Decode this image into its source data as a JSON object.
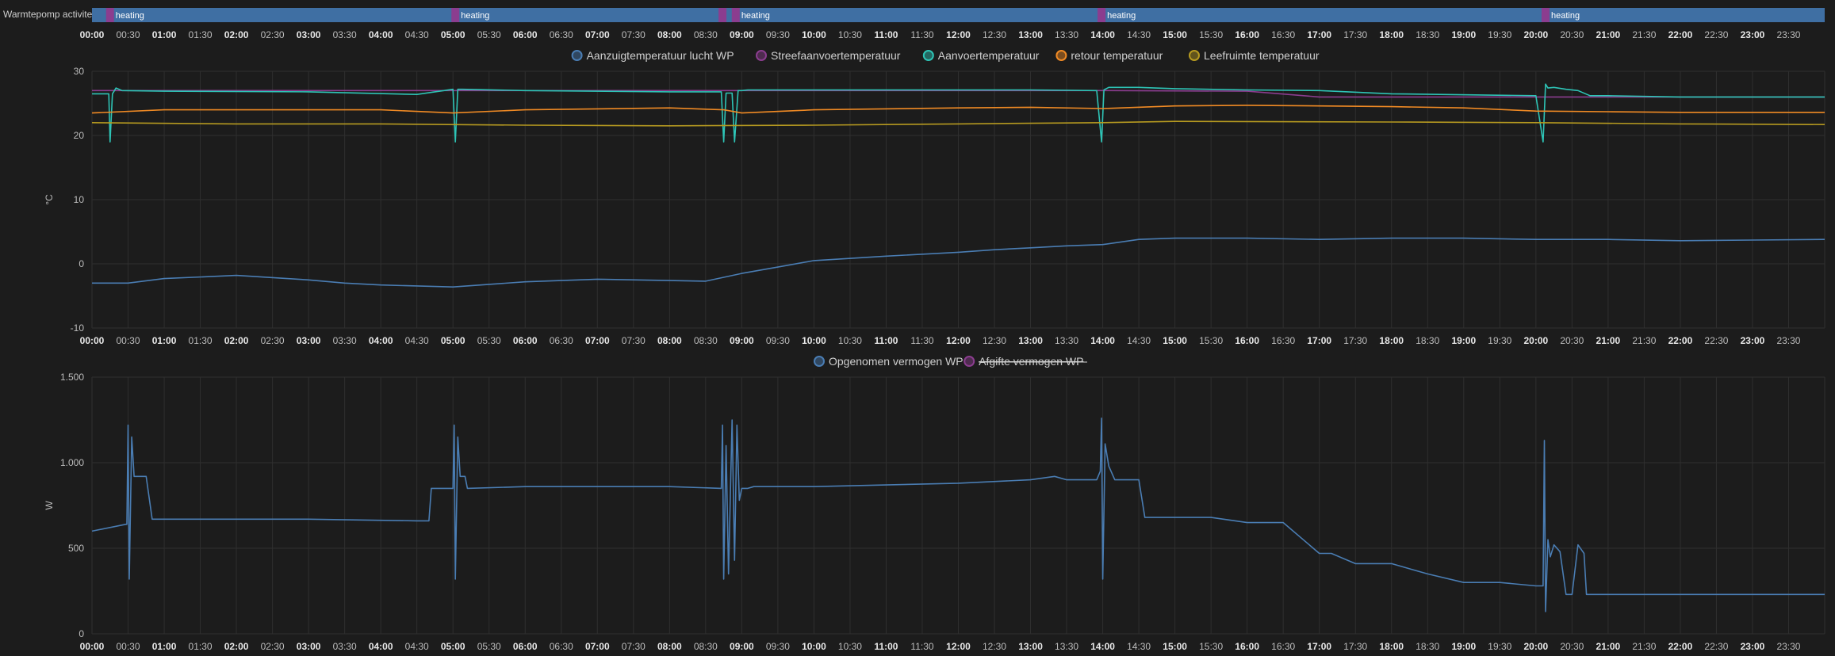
{
  "timeline": {
    "title": "Warmtepomp activiteit",
    "state_label": "heating",
    "color_heating": "#3f6fa3",
    "color_marker": "#8b3d8f",
    "segments": [
      {
        "start": "00:00",
        "end": "00:14",
        "label": "heating"
      },
      {
        "start": "00:17",
        "end": "05:00",
        "label": "heating"
      },
      {
        "start": "05:04",
        "end": "08:43",
        "label": "heating"
      },
      {
        "start": "08:46",
        "end": "08:54",
        "label": ""
      },
      {
        "start": "08:57",
        "end": "13:58",
        "label": "heating"
      },
      {
        "start": "14:01",
        "end": "20:07",
        "label": "heating"
      },
      {
        "start": "20:10",
        "end": "24:00",
        "label": "heating"
      }
    ],
    "markers": [
      "00:15",
      "05:02",
      "08:44",
      "08:55",
      "13:59",
      "20:08"
    ]
  },
  "time_ticks": [
    "00:00",
    "00:30",
    "01:00",
    "01:30",
    "02:00",
    "02:30",
    "03:00",
    "03:30",
    "04:00",
    "04:30",
    "05:00",
    "05:30",
    "06:00",
    "06:30",
    "07:00",
    "07:30",
    "08:00",
    "08:30",
    "09:00",
    "09:30",
    "10:00",
    "10:30",
    "11:00",
    "11:30",
    "12:00",
    "12:30",
    "13:00",
    "13:30",
    "14:00",
    "14:30",
    "15:00",
    "15:30",
    "16:00",
    "16:30",
    "17:00",
    "17:30",
    "18:00",
    "18:30",
    "19:00",
    "19:30",
    "20:00",
    "20:30",
    "21:00",
    "21:30",
    "22:00",
    "22:30",
    "23:00",
    "23:30"
  ],
  "chart_data": [
    {
      "type": "line",
      "ylabel": "°C",
      "ylim": [
        -10,
        30
      ],
      "yticks": [
        "-10",
        "0",
        "10",
        "20",
        "30"
      ],
      "x_range": [
        "00:00",
        "24:00"
      ],
      "grid": true,
      "legend_position": "top-center",
      "series": [
        {
          "name": "Aanzuigtemperatuur lucht WP",
          "color": "#4a7db3",
          "x": [
            "00:00",
            "00:30",
            "01:00",
            "02:00",
            "03:00",
            "03:30",
            "04:00",
            "05:00",
            "05:30",
            "06:00",
            "07:00",
            "08:00",
            "08:30",
            "09:00",
            "09:30",
            "10:00",
            "11:00",
            "12:00",
            "12:30",
            "13:00",
            "13:30",
            "14:00",
            "14:30",
            "15:00",
            "16:00",
            "17:00",
            "18:00",
            "19:00",
            "20:00",
            "21:00",
            "22:00",
            "23:00",
            "24:00"
          ],
          "values": [
            -3,
            -3,
            -2.3,
            -1.8,
            -2.5,
            -3,
            -3.3,
            -3.6,
            -3.2,
            -2.8,
            -2.4,
            -2.6,
            -2.7,
            -1.5,
            -0.5,
            0.5,
            1.2,
            1.8,
            2.2,
            2.5,
            2.8,
            3,
            3.8,
            4,
            4,
            3.8,
            4,
            4,
            3.8,
            3.8,
            3.6,
            3.7,
            3.8
          ]
        },
        {
          "name": "Streefaanvoertemperatuur",
          "color": "#8b3d8f",
          "x": [
            "00:00",
            "02:00",
            "05:00",
            "08:00",
            "09:00",
            "12:00",
            "14:00",
            "16:00",
            "17:00",
            "20:00",
            "24:00"
          ],
          "values": [
            27,
            27,
            27,
            27,
            27,
            27,
            27,
            26.9,
            26,
            26,
            26
          ]
        },
        {
          "name": "Aanvoertemperatuur",
          "color": "#2ec4b6",
          "x": [
            "00:00",
            "00:14",
            "00:15",
            "00:17",
            "00:20",
            "00:25",
            "01:00",
            "03:00",
            "04:30",
            "05:00",
            "05:02",
            "05:04",
            "05:08",
            "06:00",
            "08:00",
            "08:43",
            "08:45",
            "08:47",
            "08:52",
            "08:54",
            "08:57",
            "09:00",
            "09:05",
            "10:00",
            "12:00",
            "13:00",
            "13:55",
            "13:59",
            "14:01",
            "14:05",
            "14:30",
            "15:00",
            "16:00",
            "17:00",
            "18:00",
            "20:00",
            "20:06",
            "20:08",
            "20:10",
            "20:15",
            "20:25",
            "20:35",
            "20:45",
            "21:00",
            "22:00",
            "23:00",
            "24:00"
          ],
          "values": [
            26.5,
            26.5,
            19,
            26.5,
            27.4,
            27,
            26.9,
            26.8,
            26.4,
            27.2,
            19,
            27.2,
            27.2,
            27,
            26.8,
            26.8,
            19,
            26.6,
            26.6,
            19,
            27,
            27,
            27.1,
            27.1,
            27.1,
            27.1,
            27,
            19,
            27.1,
            27.5,
            27.5,
            27.3,
            27.1,
            27,
            26.5,
            26.2,
            19,
            28,
            27.4,
            27.5,
            27.2,
            27,
            26.2,
            26.2,
            26,
            26,
            26
          ]
        },
        {
          "name": "retour temperatuur",
          "color": "#f08a24",
          "x": [
            "00:00",
            "01:00",
            "02:00",
            "04:00",
            "05:00",
            "06:00",
            "08:00",
            "08:45",
            "09:00",
            "10:00",
            "12:00",
            "13:00",
            "14:00",
            "15:00",
            "16:00",
            "17:00",
            "18:00",
            "19:00",
            "20:00",
            "21:00",
            "22:00",
            "23:00",
            "24:00"
          ],
          "values": [
            23.5,
            24,
            24,
            24,
            23.5,
            24,
            24.3,
            24,
            23.5,
            24,
            24.3,
            24.4,
            24.2,
            24.6,
            24.7,
            24.6,
            24.5,
            24.3,
            23.8,
            23.7,
            23.6,
            23.6,
            23.6
          ]
        },
        {
          "name": "Leefruimte temperatuur",
          "color": "#b69a20",
          "x": [
            "00:00",
            "02:00",
            "04:00",
            "06:00",
            "08:00",
            "10:00",
            "12:00",
            "14:00",
            "15:00",
            "18:00",
            "20:00",
            "22:00",
            "24:00"
          ],
          "values": [
            22,
            21.8,
            21.8,
            21.6,
            21.5,
            21.6,
            21.8,
            22,
            22.2,
            22.1,
            22,
            21.8,
            21.7
          ]
        }
      ]
    },
    {
      "type": "line",
      "ylabel": "W",
      "ylim": [
        0,
        1500
      ],
      "yticks": [
        "0",
        "500",
        "1.000",
        "1.500"
      ],
      "x_range": [
        "00:00",
        "24:00"
      ],
      "grid": true,
      "legend_position": "top-center",
      "series": [
        {
          "name": "Opgenomen vermogen WP",
          "color": "#4a7db3",
          "x": [
            "00:00",
            "00:28",
            "00:29",
            "00:30",
            "00:31",
            "00:33",
            "00:35",
            "00:38",
            "00:40",
            "00:45",
            "00:50",
            "00:55",
            "01:00",
            "03:00",
            "04:30",
            "04:40",
            "04:42",
            "04:45",
            "05:00",
            "05:01",
            "05:02",
            "05:04",
            "05:06",
            "05:08",
            "05:10",
            "05:12",
            "06:00",
            "08:00",
            "08:43",
            "08:44",
            "08:45",
            "08:47",
            "08:49",
            "08:52",
            "08:54",
            "08:56",
            "08:58",
            "09:00",
            "09:05",
            "09:10",
            "09:15",
            "10:00",
            "12:00",
            "13:00",
            "13:20",
            "13:30",
            "13:35",
            "13:55",
            "13:58",
            "13:59",
            "14:00",
            "14:02",
            "14:05",
            "14:10",
            "14:30",
            "14:35",
            "15:00",
            "15:30",
            "16:00",
            "16:30",
            "17:00",
            "17:10",
            "17:30",
            "18:00",
            "18:30",
            "19:00",
            "19:30",
            "20:00",
            "20:06",
            "20:07",
            "20:08",
            "20:10",
            "20:12",
            "20:15",
            "20:20",
            "20:25",
            "20:30",
            "20:35",
            "20:40",
            "20:42",
            "20:45",
            "20:50",
            "21:00",
            "24:00"
          ],
          "values": [
            600,
            640,
            640,
            1220,
            320,
            1150,
            920,
            920,
            920,
            920,
            670,
            670,
            670,
            670,
            660,
            660,
            850,
            850,
            850,
            1220,
            320,
            1150,
            920,
            920,
            920,
            850,
            860,
            860,
            850,
            1220,
            320,
            1100,
            350,
            1250,
            430,
            1220,
            780,
            850,
            850,
            860,
            860,
            860,
            880,
            900,
            920,
            900,
            900,
            900,
            950,
            1260,
            320,
            1110,
            980,
            900,
            900,
            680,
            680,
            680,
            650,
            650,
            470,
            470,
            410,
            410,
            350,
            300,
            300,
            280,
            280,
            1130,
            130,
            550,
            450,
            520,
            480,
            230,
            230,
            520,
            470,
            230,
            230,
            230,
            230,
            230
          ]
        },
        {
          "name": "Afgifte vermogen WP",
          "color": "#8b3d8f",
          "hidden": true,
          "x": [],
          "values": []
        }
      ]
    }
  ]
}
